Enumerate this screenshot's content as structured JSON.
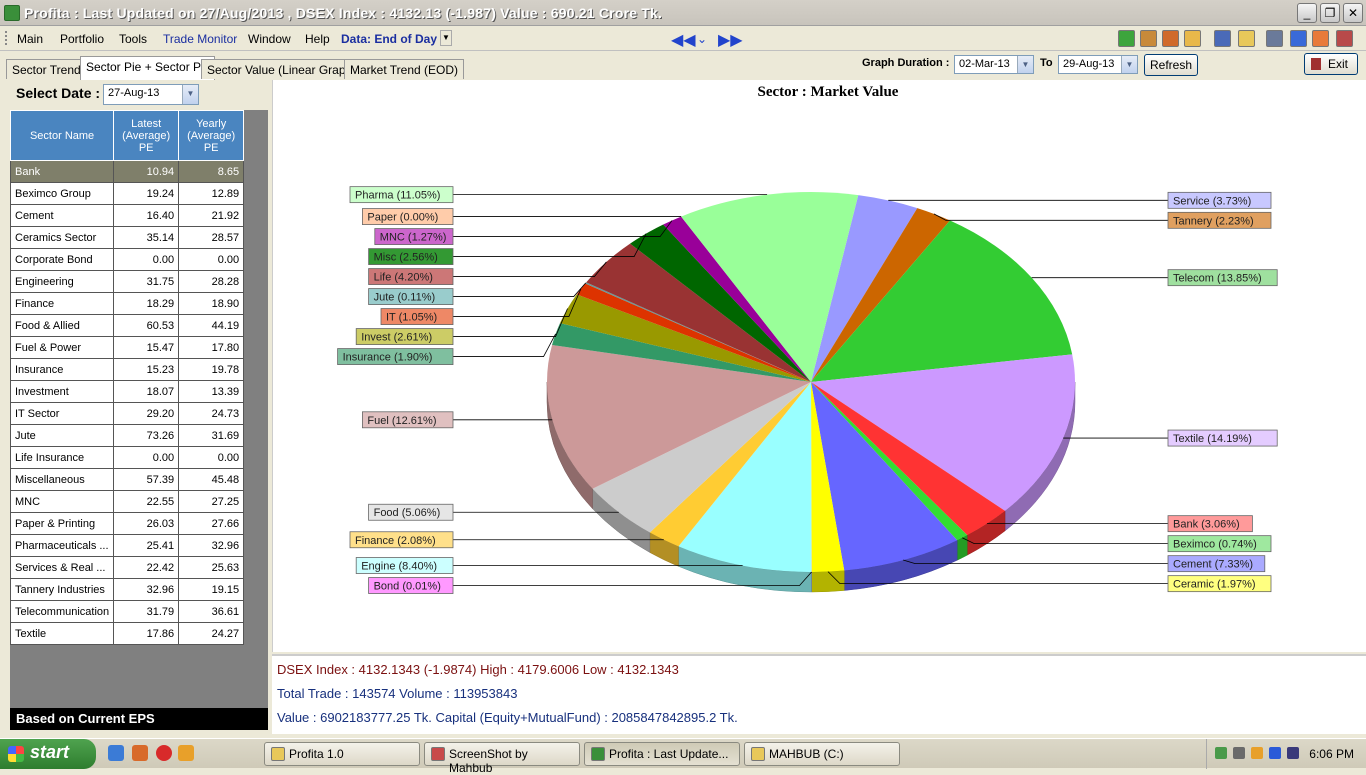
{
  "window": {
    "title": "Profita : Last Updated on 27/Aug/2013 ,  DSEX Index : 4132.13 (-1.987)  Value : 690.21 Crore Tk."
  },
  "menu": {
    "items": [
      "Main",
      "Portfolio",
      "Tools",
      "Trade Monitor",
      "Window",
      "Help"
    ],
    "data_mode": "Data: End of Day"
  },
  "tabs": [
    "Sector Trend",
    "Sector Pie + Sector PE",
    "Sector Value (Linear Graph)",
    "Market Trend (EOD)"
  ],
  "duration": {
    "label": "Graph Duration :",
    "from": "02-Mar-13",
    "to_label": "To",
    "to": "29-Aug-13",
    "refresh": "Refresh",
    "exit": "Exit"
  },
  "left": {
    "select_label": "Select Date :",
    "date": "27-Aug-13",
    "headers": [
      "Sector Name",
      "Latest (Average) PE",
      "Yearly (Average) PE"
    ],
    "rows": [
      [
        "Bank",
        "10.94",
        "8.65"
      ],
      [
        "Beximco Group",
        "19.24",
        "12.89"
      ],
      [
        "Cement",
        "16.40",
        "21.92"
      ],
      [
        "Ceramics Sector",
        "35.14",
        "28.57"
      ],
      [
        "Corporate Bond",
        "0.00",
        "0.00"
      ],
      [
        "Engineering",
        "31.75",
        "28.28"
      ],
      [
        "Finance",
        "18.29",
        "18.90"
      ],
      [
        "Food & Allied",
        "60.53",
        "44.19"
      ],
      [
        "Fuel & Power",
        "15.47",
        "17.80"
      ],
      [
        "Insurance",
        "15.23",
        "19.78"
      ],
      [
        "Investment",
        "18.07",
        "13.39"
      ],
      [
        "IT Sector",
        "29.20",
        "24.73"
      ],
      [
        "Jute",
        "73.26",
        "31.69"
      ],
      [
        "Life Insurance",
        "0.00",
        "0.00"
      ],
      [
        "Miscellaneous",
        "57.39",
        "45.48"
      ],
      [
        "MNC",
        "22.55",
        "27.25"
      ],
      [
        "Paper & Printing",
        "26.03",
        "27.66"
      ],
      [
        "Pharmaceuticals ...",
        "25.41",
        "32.96"
      ],
      [
        "Services & Real ...",
        "22.42",
        "25.63"
      ],
      [
        "Tannery Industries",
        "32.96",
        "19.15"
      ],
      [
        "Telecommunication",
        "31.79",
        "36.61"
      ],
      [
        "Textile",
        "17.86",
        "24.27"
      ]
    ],
    "footnote": "Based on Current EPS"
  },
  "chart_data": {
    "type": "pie",
    "title": "Sector : Market Value",
    "slices": [
      {
        "name": "Service",
        "label": "Service (3.73%)",
        "value": 3.73,
        "color": "#9999ff",
        "lcolor": "#c8c8ff",
        "side": "right"
      },
      {
        "name": "Tannery",
        "label": "Tannery (2.23%)",
        "value": 2.23,
        "color": "#cc6600",
        "lcolor": "#e0a060",
        "side": "right"
      },
      {
        "name": "Telecom",
        "label": "Telecom (13.85%)",
        "value": 13.85,
        "color": "#33cc33",
        "lcolor": "#9fe09f",
        "side": "right"
      },
      {
        "name": "Textile",
        "label": "Textile (14.19%)",
        "value": 14.19,
        "color": "#cc99ff",
        "lcolor": "#e4ccff",
        "side": "right"
      },
      {
        "name": "Bank",
        "label": "Bank (3.06%)",
        "value": 3.06,
        "color": "#ff3333",
        "lcolor": "#ff9a9a",
        "side": "right"
      },
      {
        "name": "Beximco",
        "label": "Beximco (0.74%)",
        "value": 0.74,
        "color": "#33dd33",
        "lcolor": "#9fe89f",
        "side": "right"
      },
      {
        "name": "Cement",
        "label": "Cement (7.33%)",
        "value": 7.33,
        "color": "#6666ff",
        "lcolor": "#aaaaff",
        "side": "right"
      },
      {
        "name": "Ceramic",
        "label": "Ceramic (1.97%)",
        "value": 1.97,
        "color": "#ffff00",
        "lcolor": "#ffff80",
        "side": "right"
      },
      {
        "name": "Bond",
        "label": "Bond (0.01%)",
        "value": 0.01,
        "color": "#ff66ff",
        "lcolor": "#ff99ff",
        "side": "left"
      },
      {
        "name": "Engine",
        "label": "Engine (8.40%)",
        "value": 8.4,
        "color": "#99ffff",
        "lcolor": "#ccffff",
        "side": "left"
      },
      {
        "name": "Finance",
        "label": "Finance (2.08%)",
        "value": 2.08,
        "color": "#ffcc33",
        "lcolor": "#ffe08a",
        "side": "left"
      },
      {
        "name": "Food",
        "label": "Food (5.06%)",
        "value": 5.06,
        "color": "#cccccc",
        "lcolor": "#e6e6e6",
        "side": "left"
      },
      {
        "name": "Fuel",
        "label": "Fuel (12.61%)",
        "value": 12.61,
        "color": "#cc9999",
        "lcolor": "#e0c0c0",
        "side": "left"
      },
      {
        "name": "Insurance",
        "label": "Insurance (1.90%)",
        "value": 1.9,
        "color": "#339966",
        "lcolor": "#7fbf9f",
        "side": "left"
      },
      {
        "name": "Invest",
        "label": "Invest (2.61%)",
        "value": 2.61,
        "color": "#999900",
        "lcolor": "#cccc66",
        "side": "left"
      },
      {
        "name": "IT",
        "label": "IT (1.05%)",
        "value": 1.05,
        "color": "#dd3300",
        "lcolor": "#ee8866",
        "side": "left"
      },
      {
        "name": "Jute",
        "label": "Jute (0.11%)",
        "value": 0.11,
        "color": "#669999",
        "lcolor": "#99cccc",
        "side": "left"
      },
      {
        "name": "Life",
        "label": "Life (4.20%)",
        "value": 4.2,
        "color": "#993333",
        "lcolor": "#cc7777",
        "side": "left"
      },
      {
        "name": "Misc",
        "label": "Misc (2.56%)",
        "value": 2.56,
        "color": "#006600",
        "lcolor": "#339933",
        "side": "left"
      },
      {
        "name": "MNC",
        "label": "MNC (1.27%)",
        "value": 1.27,
        "color": "#990099",
        "lcolor": "#cc66cc",
        "side": "left"
      },
      {
        "name": "Paper",
        "label": "Paper (0.00%)",
        "value": 0.0,
        "color": "#ff9966",
        "lcolor": "#ffccaa",
        "side": "left"
      },
      {
        "name": "Pharma",
        "label": "Pharma (11.05%)",
        "value": 11.05,
        "color": "#99ff99",
        "lcolor": "#ccffcc",
        "side": "left"
      }
    ]
  },
  "stats": {
    "line1": "DSEX Index : 4132.1343 (-1.9874)   High : 4179.6006   Low : 4132.1343",
    "line2": "Total Trade : 143574     Volume : 113953843",
    "line3": "Value : 6902183777.25 Tk.     Capital (Equity+MutualFund) : 2085847842895.2 Tk."
  },
  "taskbar": {
    "start": "start",
    "tasks": [
      "Profita 1.0",
      "ScreenShot by Mahbub",
      "Profita : Last Update...",
      "MAHBUB (C:)"
    ],
    "clock": "6:06 PM"
  }
}
